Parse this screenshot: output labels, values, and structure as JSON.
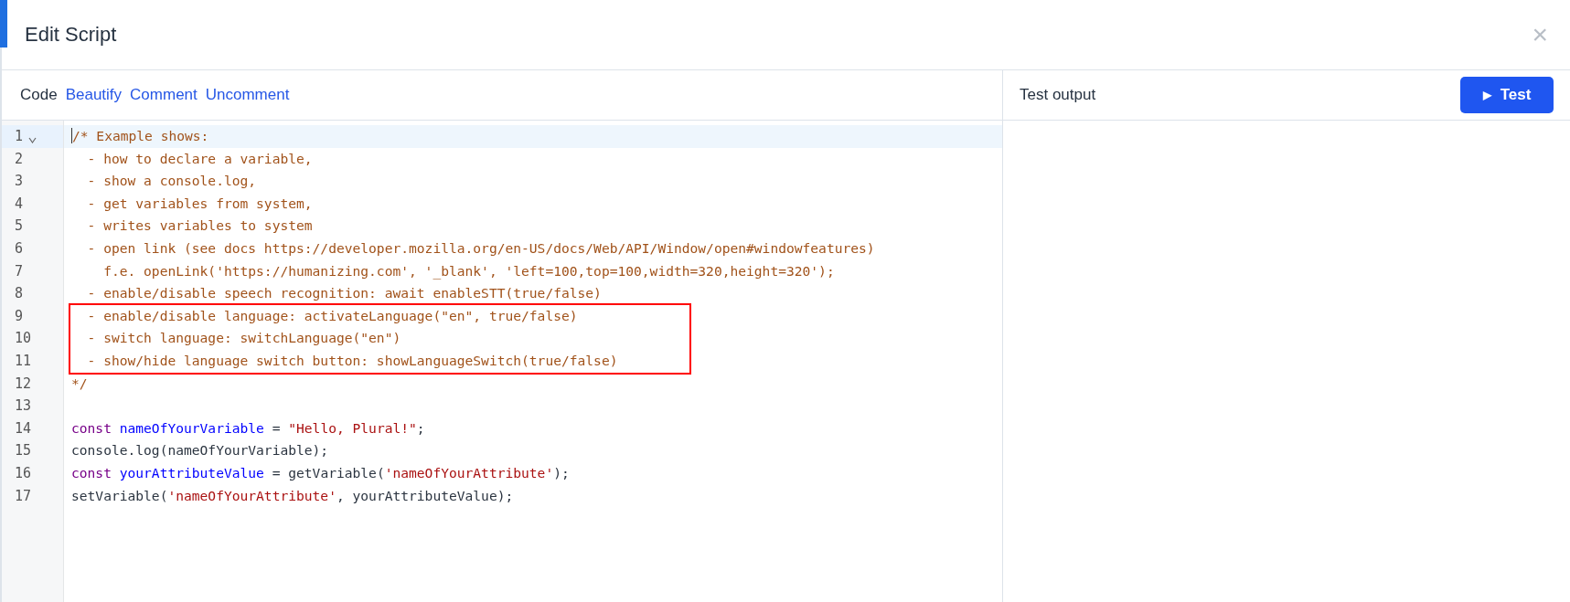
{
  "dialog": {
    "title": "Edit Script",
    "close": "×"
  },
  "toolbar": {
    "label": "Code",
    "actions": [
      "Beautify",
      "Comment",
      "Uncomment"
    ]
  },
  "output_panel": {
    "title": "Test output",
    "button": {
      "icon": "▶",
      "label": "Test"
    }
  },
  "editor": {
    "blocks": [
      {
        "framed": false,
        "lines": [
          {
            "number": "1",
            "active": true,
            "foldable": true,
            "tokens": [
              {
                "kind": "comment",
                "text": "/* Example shows:"
              }
            ]
          },
          {
            "number": "2",
            "active": false,
            "foldable": false,
            "tokens": [
              {
                "kind": "comment",
                "text": "  - how to declare a variable,"
              }
            ]
          },
          {
            "number": "3",
            "active": false,
            "foldable": false,
            "tokens": [
              {
                "kind": "comment",
                "text": "  - show a console.log,"
              }
            ]
          },
          {
            "number": "4",
            "active": false,
            "foldable": false,
            "tokens": [
              {
                "kind": "comment",
                "text": "  - get variables from system,"
              }
            ]
          },
          {
            "number": "5",
            "active": false,
            "foldable": false,
            "tokens": [
              {
                "kind": "comment",
                "text": "  - writes variables to system"
              }
            ]
          },
          {
            "number": "6",
            "active": false,
            "foldable": false,
            "tokens": [
              {
                "kind": "comment",
                "text": "  - open link (see docs https://developer.mozilla.org/en-US/docs/Web/API/Window/open#windowfeatures)"
              }
            ]
          },
          {
            "number": "7",
            "active": false,
            "foldable": false,
            "tokens": [
              {
                "kind": "comment",
                "text": "    f.e. openLink('https://humanizing.com', '_blank', 'left=100,top=100,width=320,height=320');"
              }
            ]
          },
          {
            "number": "8",
            "active": false,
            "foldable": false,
            "tokens": [
              {
                "kind": "comment",
                "text": "  - enable/disable speech recognition: await enableSTT(true/false)"
              }
            ]
          }
        ]
      },
      {
        "framed": true,
        "lines": [
          {
            "number": "9",
            "active": false,
            "foldable": false,
            "tokens": [
              {
                "kind": "comment",
                "text": "  - enable/disable language: activateLanguage(\"en\", true/false)"
              }
            ]
          },
          {
            "number": "10",
            "active": false,
            "foldable": false,
            "tokens": [
              {
                "kind": "comment",
                "text": "  - switch language: switchLanguage(\"en\")"
              }
            ]
          },
          {
            "number": "11",
            "active": false,
            "foldable": false,
            "tokens": [
              {
                "kind": "comment",
                "text": "  - show/hide language switch button: showLanguageSwitch(true/false)"
              }
            ]
          }
        ]
      },
      {
        "framed": false,
        "lines": [
          {
            "number": "12",
            "active": false,
            "foldable": false,
            "tokens": [
              {
                "kind": "comment",
                "text": "*/"
              }
            ]
          },
          {
            "number": "13",
            "active": false,
            "foldable": false
          },
          {
            "number": "14",
            "active": false,
            "foldable": false,
            "tokens": [
              {
                "kind": "keyword",
                "text": "const"
              },
              {
                "kind": "def",
                "text": " nameOfYourVariable"
              },
              {
                "kind": "plain",
                "text": " = "
              },
              {
                "kind": "string",
                "text": "\"Hello, Plural!\""
              },
              {
                "kind": "plain",
                "text": ";"
              }
            ]
          },
          {
            "number": "15",
            "active": false,
            "foldable": false,
            "tokens": [
              {
                "kind": "plain",
                "text": "console.log(nameOfYourVariable);"
              }
            ]
          },
          {
            "number": "16",
            "active": false,
            "foldable": false,
            "tokens": [
              {
                "kind": "keyword",
                "text": "const"
              },
              {
                "kind": "def",
                "text": " yourAttributeValue"
              },
              {
                "kind": "plain",
                "text": " = getVariable("
              },
              {
                "kind": "string",
                "text": "'nameOfYourAttribute'"
              },
              {
                "kind": "plain",
                "text": ");"
              }
            ]
          },
          {
            "number": "17",
            "active": false,
            "foldable": false,
            "tokens": [
              {
                "kind": "plain",
                "text": "setVariable("
              },
              {
                "kind": "string",
                "text": "'nameOfYourAttribute'"
              },
              {
                "kind": "plain",
                "text": ", yourAttributeValue);"
              }
            ]
          }
        ]
      }
    ]
  }
}
